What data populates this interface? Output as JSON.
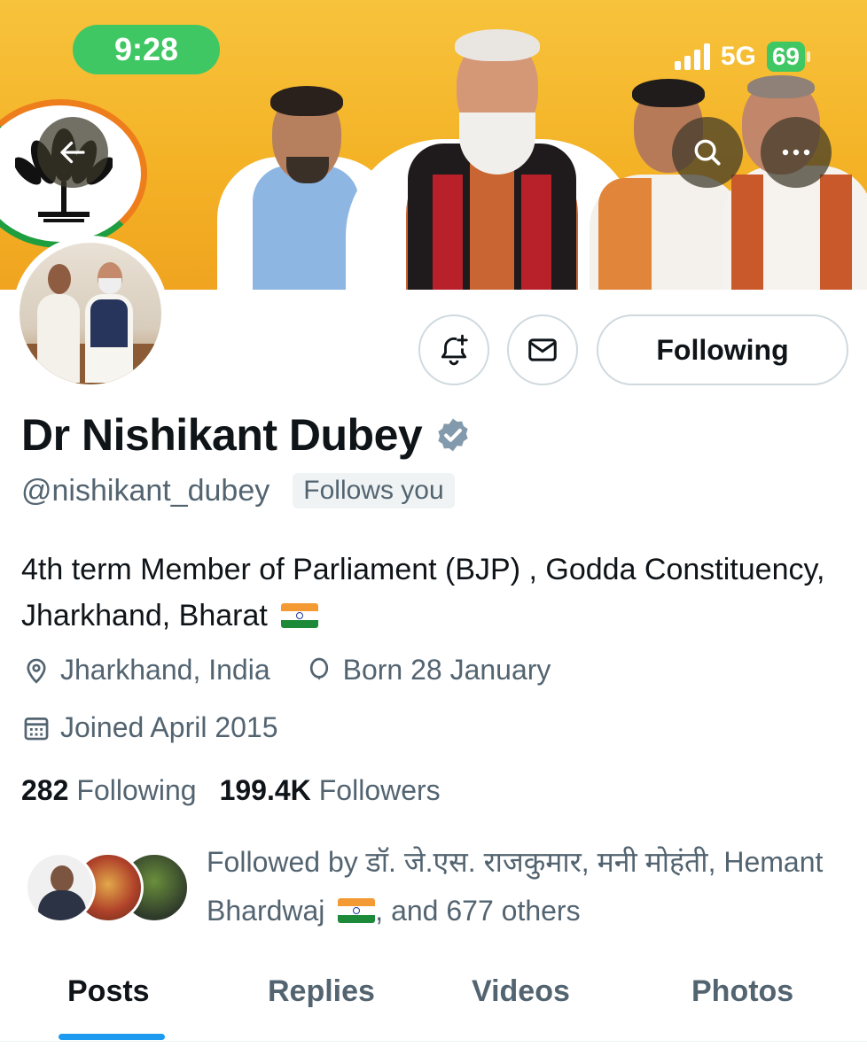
{
  "status_bar": {
    "time": "9:28",
    "network": "5G",
    "battery": "69"
  },
  "header": {
    "back_icon": "arrow-left-icon",
    "search_icon": "search-icon",
    "more_icon": "more-horizontal-icon"
  },
  "profile": {
    "display_name": "Dr Nishikant Dubey",
    "verified_icon": "verified-badge-icon",
    "handle": "@nishikant_dubey",
    "follows_you": "Follows you",
    "bio": "4th term Member of Parliament (BJP) , Godda Constituency, Jharkhand, Bharat",
    "location": "Jharkhand, India",
    "birthday": "Born 28 January",
    "joined": "Joined April 2015",
    "following_count": "282",
    "following_label": "Following",
    "followers_count": "199.4K",
    "followers_label": "Followers"
  },
  "actions": {
    "notify_icon": "bell-plus-icon",
    "message_icon": "mail-icon",
    "following_button": "Following"
  },
  "followed_by": {
    "prefix": "Followed by ",
    "names": "डॉ. जे.एस. राजकुमार, मनी मोहंती, Hemant Bhardwaj",
    "suffix": ", and 677 others"
  },
  "tabs": [
    {
      "label": "Posts",
      "active": true
    },
    {
      "label": "Replies",
      "active": false
    },
    {
      "label": "Videos",
      "active": false
    },
    {
      "label": "Photos",
      "active": false
    }
  ],
  "colors": {
    "accent": "#1d9bf0",
    "banner": "#f4b327",
    "secondary_text": "#536471",
    "status_green": "#3fc763"
  }
}
